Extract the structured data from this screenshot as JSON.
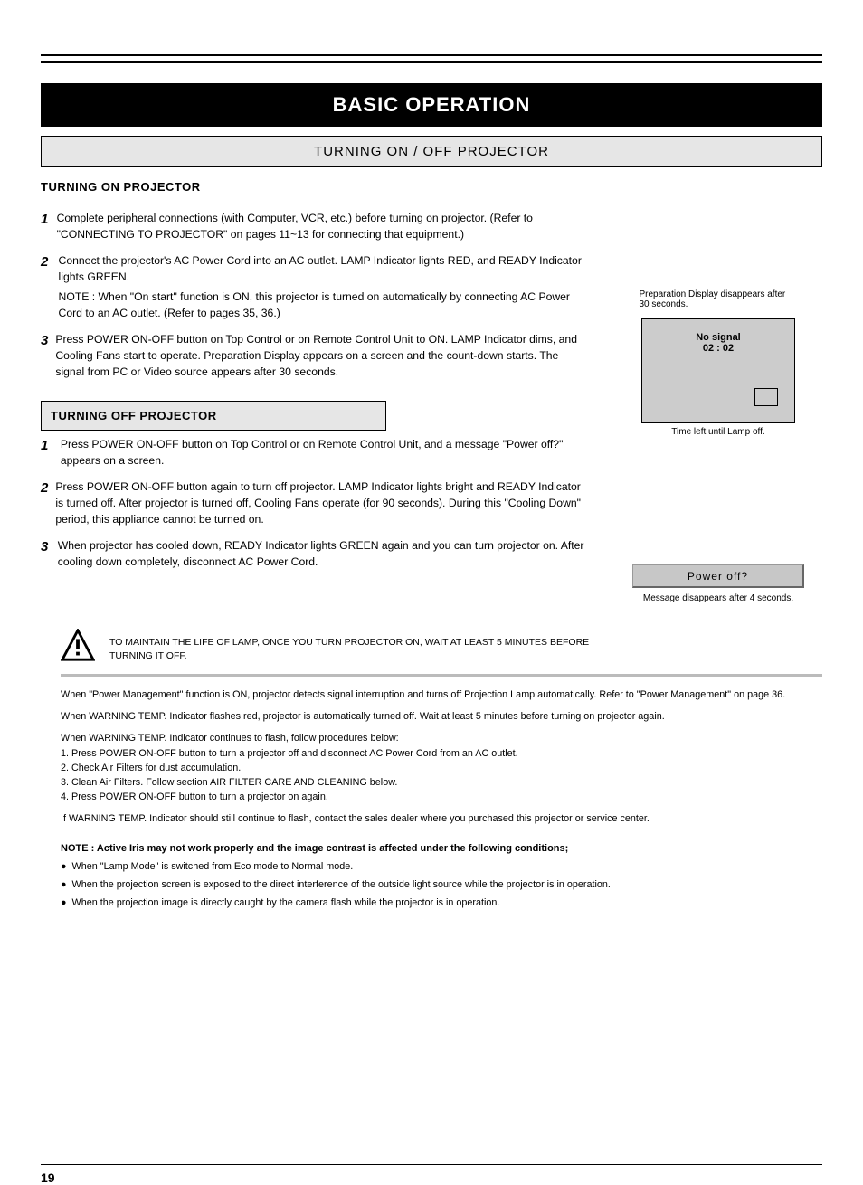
{
  "title": "BASIC OPERATION",
  "subtitle": "TURNING ON / OFF PROJECTOR",
  "turning_on": {
    "header": "TURNING ON PROJECTOR",
    "step1_num": "1",
    "step1_text": "Complete peripheral connections (with Computer, VCR, etc.) before turning on projector.  (Refer to \"CONNECTING TO PROJECTOR\" on pages 11~13 for connecting that equipment.)",
    "step2_num": "2",
    "step2_text": "Connect the projector's AC Power Cord into an AC outlet. LAMP Indicator lights RED, and READY Indicator lights GREEN.",
    "step2_note": "NOTE : When \"On start\" function is ON, this projector is turned on automatically by connecting AC Power Cord to an AC outlet. (Refer to pages 35, 36.)",
    "step3_num": "3",
    "step3_text": "Press POWER ON-OFF button on Top Control or on Remote Control Unit to ON. LAMP Indicator dims, and Cooling Fans start to operate.  Preparation Display appears on a screen and the count-down starts. The signal from PC or Video source appears after 30 seconds."
  },
  "nosignal": {
    "line1_top": "No signal",
    "line1_bottom": "02 : 02",
    "caption": "Time left until Lamp off."
  },
  "right_caption": "Preparation Display disappears after 30 seconds.",
  "turning_off": {
    "header": "TURNING OFF PROJECTOR",
    "step1_num": "1",
    "step1_text": "Press POWER ON-OFF button on Top Control or on Remote Control Unit, and a message \"Power off?\" appears on a screen.",
    "step2_num": "2",
    "step2_text": "Press POWER ON-OFF button again to turn off projector. LAMP Indicator lights bright and READY Indicator is turned off. After projector is turned off, Cooling Fans operate (for 90 seconds). During this \"Cooling Down\" period, this appliance cannot be turned on.",
    "step3_num": "3",
    "step3_text": "When projector has cooled down, READY Indicator lights GREEN again and you can turn projector on. After cooling down completely, disconnect AC Power Cord."
  },
  "poweroff_button": "Power off?",
  "poweroff_caption": "Message disappears after 4 seconds.",
  "caution": "TO MAINTAIN THE LIFE OF LAMP, ONCE YOU TURN PROJECTOR ON, WAIT AT LEAST 5 MINUTES BEFORE TURNING IT OFF.",
  "power_mgmt": {
    "p1": "When \"Power Management\" function is ON, projector detects signal interruption and turns off Projection Lamp automatically.  Refer to \"Power Management\" on page 36.",
    "p2": "When WARNING TEMP. Indicator flashes red, projector is automatically turned off.  Wait at least 5 minutes before turning on projector again.",
    "p3_lead": "When WARNING TEMP. Indicator continues to flash, follow procedures below:",
    "p3_s1": "1. Press POWER ON-OFF button to turn a projector off and disconnect AC Power Cord from an AC outlet.",
    "p3_s2": "2. Check Air Filters for dust accumulation.",
    "p3_s3": "3. Clean Air Filters.  Follow section AIR FILTER CARE AND CLEANING below.",
    "p3_s4": "4. Press POWER ON-OFF button to turn a projector on again.",
    "p4": "If WARNING TEMP. Indicator should still continue to flash, contact the sales dealer where you purchased this projector or service center."
  },
  "note": {
    "head": "NOTE : Active Iris may not work properly and the image contrast is affected under the following conditions;",
    "b1": "When \"Lamp Mode\" is switched from Eco mode to Normal mode.",
    "b2": "When the projection screen is exposed to the direct interference of the outside light source while the projector is in operation.",
    "b3": "When the projection image is directly caught by the camera flash while the projector is in operation."
  },
  "page_num": "19"
}
